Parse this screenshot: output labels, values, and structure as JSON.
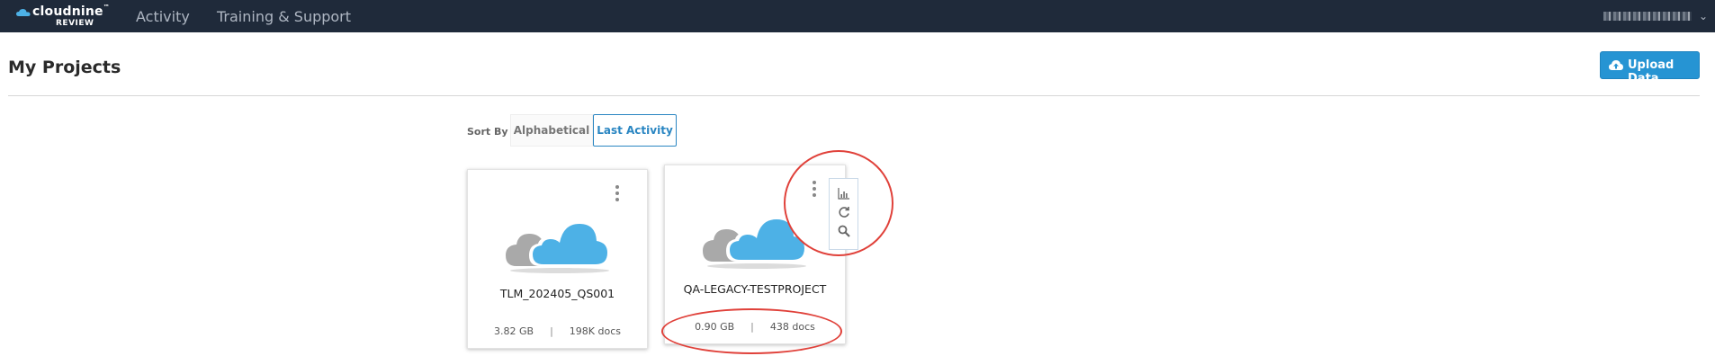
{
  "app": {
    "logo_text": "cloudnine",
    "logo_tm": "™",
    "logo_sub": "REVIEW"
  },
  "nav": {
    "items": [
      {
        "label": "Activity"
      },
      {
        "label": "Training & Support"
      }
    ]
  },
  "page": {
    "title": "My Projects",
    "upload_label": "Upload Data"
  },
  "sort": {
    "label": "Sort By -",
    "options": [
      {
        "label": "Alphabetical",
        "selected": false
      },
      {
        "label": "Last Activity",
        "selected": true
      }
    ]
  },
  "projects": [
    {
      "name": "TLM_202405_QS001",
      "size": "3.82 GB",
      "docs": "198K docs"
    },
    {
      "name": "QA-LEGACY-TESTPROJECT",
      "size": "0.90 GB",
      "docs": "438 docs"
    }
  ],
  "stats_separator": "|",
  "action_menu": {
    "icons": [
      "bar-chart-icon",
      "refresh-icon",
      "search-icon"
    ]
  },
  "colors": {
    "topbar": "#1f2a3a",
    "accent": "#2694d3",
    "cloud_blue": "#4db1e6",
    "cloud_gray": "#a9a9a9",
    "annotation_red": "#e0413a"
  }
}
